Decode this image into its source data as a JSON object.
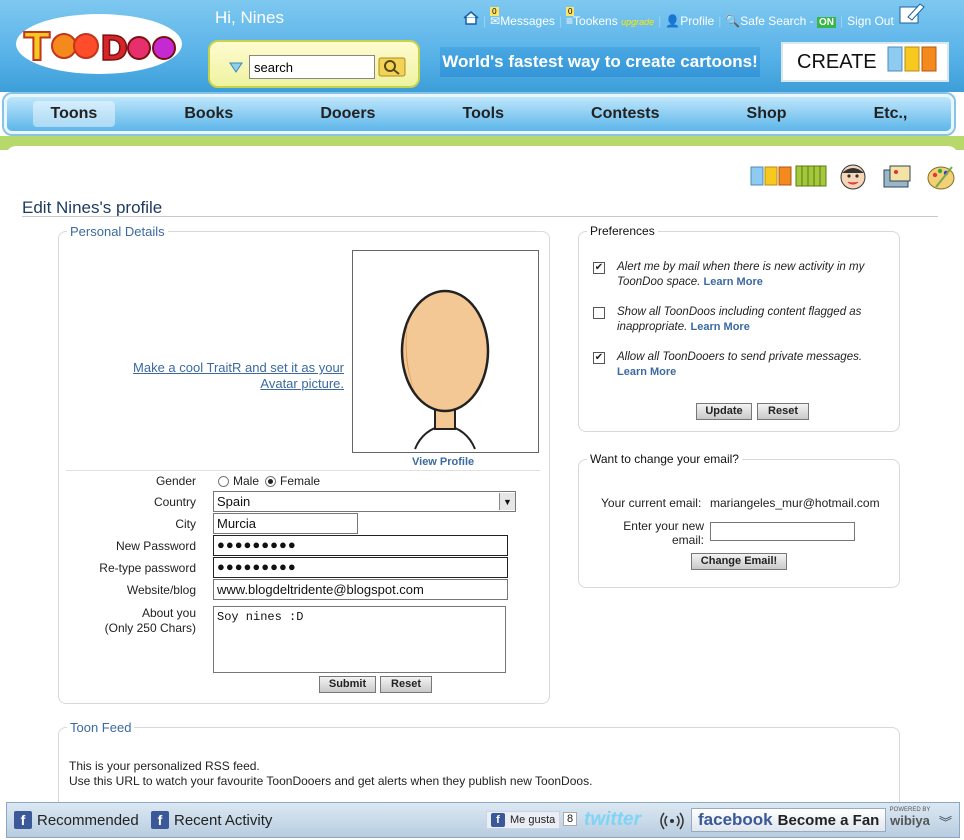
{
  "header": {
    "greeting": "Hi, Nines",
    "nav": {
      "messages": "Messages",
      "messages_count": "0",
      "tookens": "Tookens",
      "tookens_count": "0",
      "upgrade": "upgrade",
      "profile": "Profile",
      "safe_search": "Safe Search -",
      "safe_state": "ON",
      "sign_out": "Sign Out"
    },
    "search_value": "search",
    "tagline": "World's fastest way to create cartoons!",
    "create_label": "CREATE"
  },
  "main_nav": [
    "Toons",
    "Books",
    "Dooers",
    "Tools",
    "Contests",
    "Shop",
    "Etc.,"
  ],
  "page": {
    "title": "Edit Nines's profile"
  },
  "personal": {
    "legend": "Personal Details",
    "traitr_link": "Make a cool TraitR and set it as your Avatar picture.",
    "view_profile": "View Profile",
    "gender_label": "Gender",
    "gender_options": [
      "Male",
      "Female"
    ],
    "gender_selected": "Female",
    "country_label": "Country",
    "country_value": "Spain",
    "city_label": "City",
    "city_value": "Murcia",
    "new_password_label": "New Password",
    "new_password_value": "●●●●●●●●●",
    "retype_password_label": "Re-type password",
    "retype_password_value": "●●●●●●●●●",
    "website_label": "Website/blog",
    "website_value": "www.blogdeltridente@blogspot.com",
    "about_label": "About you",
    "about_sub": "(Only 250 Chars)",
    "about_value": "Soy nines :D",
    "submit": "Submit",
    "reset": "Reset"
  },
  "preferences": {
    "legend": "Preferences",
    "items": [
      {
        "text": "Alert me by mail when there is new activity in my ToonDoo space.",
        "learn": "Learn More",
        "checked": true
      },
      {
        "text": "Show all ToonDoos including content flagged as inappropriate.",
        "learn": "Learn More",
        "checked": false
      },
      {
        "text": "Allow all ToonDooers to send private messages.",
        "learn": "Learn More",
        "checked": true
      }
    ],
    "update": "Update",
    "reset": "Reset"
  },
  "email": {
    "legend": "Want to change your email?",
    "current_label": "Your current email:",
    "current_value": "mariangeles_mur@hotmail.com",
    "new_label": "Enter your new email:",
    "new_value": "",
    "button": "Change Email!"
  },
  "feed": {
    "legend": "Toon Feed",
    "line1": "This is your personalized RSS feed.",
    "line2": "Use this URL to watch your favourite ToonDooers and get alerts when they publish new ToonDoos."
  },
  "bottom_bar": {
    "recommended": "Recommended",
    "recent_activity": "Recent Activity",
    "like": "Me gusta",
    "like_count": "8",
    "twitter": "twitter",
    "facebook": "facebook",
    "become_fan": "Become a Fan",
    "powered_by": "POWERED BY",
    "wibiya": "wibiya"
  },
  "colors": {
    "header_blue": "#58b2e8",
    "link_blue": "#3b6aa0",
    "green_strip": "#b7d86a",
    "on_badge": "#39b54a"
  }
}
